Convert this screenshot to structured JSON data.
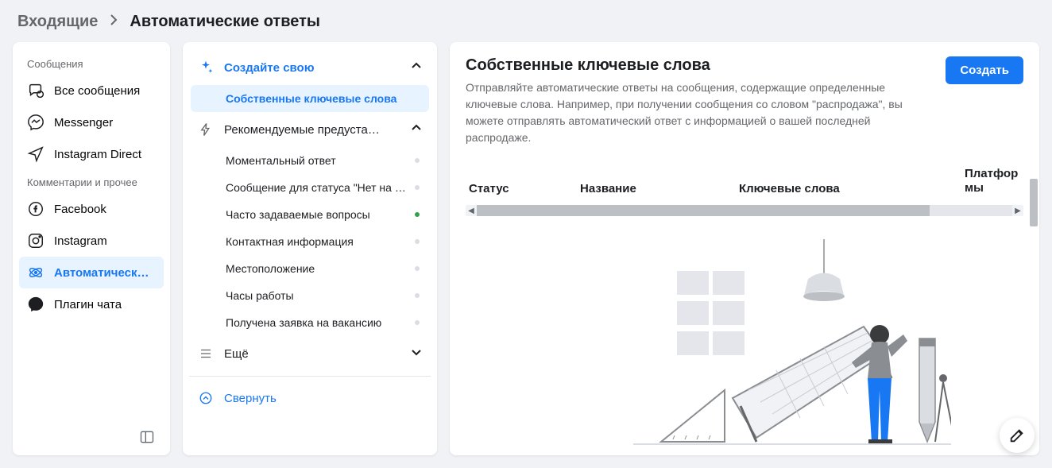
{
  "breadcrumb": {
    "parent": "Входящие",
    "current": "Автоматические ответы"
  },
  "sidebar": {
    "section_messages": "Сообщения",
    "section_comments": "Комментарии и прочее",
    "items": [
      {
        "label": "Все сообщения"
      },
      {
        "label": "Messenger"
      },
      {
        "label": "Instagram Direct"
      },
      {
        "label": "Facebook"
      },
      {
        "label": "Instagram"
      },
      {
        "label": "Автоматическ…"
      },
      {
        "label": "Плагин чата"
      }
    ]
  },
  "middle": {
    "create_label": "Создайте свою",
    "create_items": [
      {
        "label": "Собственные ключевые слова"
      }
    ],
    "recs_label": "Рекомендуемые предуста…",
    "recs_items": [
      {
        "label": "Моментальный ответ",
        "active": false
      },
      {
        "label": "Сообщение для статуса \"Нет на ме…",
        "active": false
      },
      {
        "label": "Часто задаваемые вопросы",
        "active": true
      },
      {
        "label": "Контактная информация",
        "active": false
      },
      {
        "label": "Местоположение",
        "active": false
      },
      {
        "label": "Часы работы",
        "active": false
      },
      {
        "label": "Получена заявка на вакансию",
        "active": false
      }
    ],
    "more_label": "Ещё",
    "collapse_label": "Свернуть"
  },
  "main": {
    "title": "Собственные ключевые слова",
    "description": "Отправляйте автоматические ответы на сообщения, содержащие определенные ключевые слова. Например, при получении сообщения со словом \"распродажа\", вы можете отправлять автоматический ответ с информацией о вашей последней распродаже.",
    "create_button": "Создать",
    "columns": {
      "status": "Статус",
      "name": "Название",
      "keywords": "Ключевые слова",
      "platforms": "Платформы"
    }
  }
}
